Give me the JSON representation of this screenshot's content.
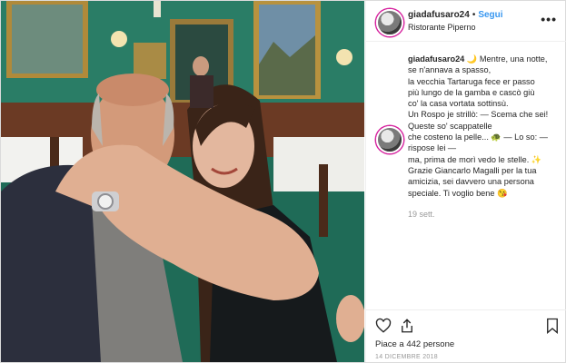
{
  "post": {
    "username": "giadafusaro24",
    "dot": "•",
    "follow_label": "Segui",
    "location": "Ristorante Piperno",
    "more_icon": "more-options-icon",
    "caption_lines": [
      "Mentre, una notte,",
      "se n'annava a spasso,",
      "la vecchia Tartaruga fece er passo",
      "più lungo de la gamba e cascò giù",
      "co' la casa vortata sottinsù.",
      "Un Rospo je strillò: — Scema che sei!",
      "Queste so' scappatelle",
      "che costeno la pelle... 🐢 — Lo so: —",
      "rispose lei —",
      "ma, prima de morì vedo le stelle. ✨",
      "Grazie Giancarlo Magalli per la tua",
      "amicizia, sei davvero una persona",
      "speciale. Ti voglio bene 😘"
    ],
    "caption_first_emoji": "🌙",
    "time_ago": "19 sett.",
    "likes_text": "Piace a 442 persone",
    "date_text": "14 DICEMBRE 2018",
    "colors": {
      "follow": "#3897f0",
      "text": "#262626",
      "muted": "#999999"
    }
  }
}
